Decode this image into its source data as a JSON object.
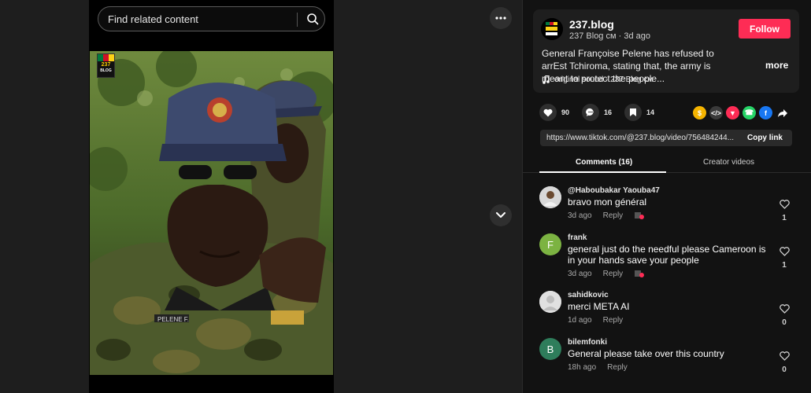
{
  "search": {
    "placeholder": "Find related content"
  },
  "video": {
    "logo_number": "237",
    "logo_text": "BLOG"
  },
  "account": {
    "name": "237.blog",
    "handle": "237 Blog ᴄᴍ",
    "time": "3d ago",
    "follow_label": "Follow"
  },
  "post": {
    "description": "General Françoise Pelene has refused to arrEst Tchiroma, stating that, the army is meant to protect the people...",
    "more_label": "more",
    "sound": "original sound - 237 Blog ᴄᴍ"
  },
  "actions": {
    "likes": "90",
    "comments": "16",
    "saves": "14"
  },
  "share_icons": [
    "coin-icon",
    "embed-icon",
    "send-icon",
    "whatsapp-icon",
    "facebook-icon",
    "share-arrow-icon"
  ],
  "link": {
    "url": "https://www.tiktok.com/@237.blog/video/756484244...",
    "copy_label": "Copy link"
  },
  "tabs": {
    "comments": "Comments (16)",
    "creator": "Creator videos"
  },
  "comments": [
    {
      "user": "@Haboubakar Yaouba47",
      "text": "bravo mon général",
      "time": "3d ago",
      "reply": "Reply",
      "likes": "1",
      "avatar_letter": "",
      "avatar_color": "#cfcfcf"
    },
    {
      "user": "frank",
      "text": "general just do the needful please Cameroon is in your hands save your people",
      "time": "3d ago",
      "reply": "Reply",
      "likes": "1",
      "avatar_letter": "F",
      "avatar_color": "#7cb342"
    },
    {
      "user": "sahidkovic",
      "text": "merci META AI",
      "time": "1d ago",
      "reply": "Reply",
      "likes": "0",
      "avatar_letter": "",
      "avatar_color": "#e0e0e0"
    },
    {
      "user": "bilemfonki",
      "text": "General please take over this country",
      "time": "18h ago",
      "reply": "Reply",
      "likes": "0",
      "avatar_letter": "B",
      "avatar_color": "#2e7d5b"
    }
  ],
  "colors": {
    "accent": "#fe2c55",
    "panel": "#121212",
    "card": "#1e1e1e"
  }
}
